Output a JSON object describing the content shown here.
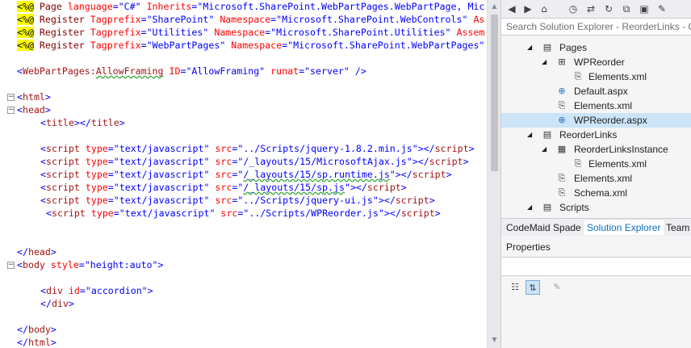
{
  "editor": {
    "lines": {
      "l1": {
        "a": "<%@",
        "b": " Page ",
        "c": "language",
        "d": "=",
        "e": "\"C#\"",
        "f": " Inherits",
        "g": "=",
        "h": "\"Microsoft.SharePoint.WebPartPages.WebPartPage, Mic"
      },
      "l2": {
        "a": "<%@",
        "b": " Register ",
        "c": "Tagprefix",
        "d": "=",
        "e": "\"SharePoint\"",
        "f": " Namespace",
        "g": "=",
        "h": "\"Microsoft.SharePoint.WebControls\"",
        "i": " As"
      },
      "l3": {
        "a": "<%@",
        "b": " Register ",
        "c": "Tagprefix",
        "d": "=",
        "e": "\"Utilities\"",
        "f": " Namespace",
        "g": "=",
        "h": "\"Microsoft.SharePoint.Utilities\"",
        "i": " Assem"
      },
      "l4": {
        "a": "<%@",
        "b": " Register ",
        "c": "Tagprefix",
        "d": "=",
        "e": "\"WebPartPages\"",
        "f": " Namespace",
        "g": "=",
        "h": "\"Microsoft.SharePoint.WebPartPages\""
      },
      "l5": {
        "a": "<",
        "b": "WebPartPages:",
        "c": "AllowFraming",
        "d": " ID",
        "e": "=",
        "f": "\"AllowFraming\"",
        "g": " runat",
        "h": "=",
        "i": "\"server\"",
        "j": " />"
      },
      "l6": {
        "a": "<",
        "b": "html",
        "c": ">"
      },
      "l7": {
        "a": "<",
        "b": "head",
        "c": ">"
      },
      "l8": {
        "a": "<",
        "b": "title",
        "c": "></",
        "d": "title",
        "e": ">"
      },
      "s1": {
        "a": "<",
        "b": "script",
        "c": " type",
        "d": "=",
        "e": "\"text/javascript\"",
        "f": " src",
        "g": "=",
        "h": "\"../Scripts/jquery-1.8.2.min.js\"",
        "i": "></",
        "j": "script",
        "k": ">"
      },
      "s2": {
        "a": "<",
        "b": "script",
        "c": " type",
        "d": "=",
        "e": "\"text/javascript\"",
        "f": " src",
        "g": "=",
        "h": "\"/_layouts/15/MicrosoftAjax.js\"",
        "i": "></",
        "j": "script",
        "k": ">"
      },
      "s3": {
        "a": "<",
        "b": "script",
        "c": " type",
        "d": "=",
        "e": "\"text/javascript\"",
        "f": " src",
        "g": "=",
        "h1": "\"",
        "h2": "/_layouts/15/sp.runtime.js",
        "h3": "\"",
        "i": "></",
        "j": "script",
        "k": ">"
      },
      "s4": {
        "a": "<",
        "b": "script",
        "c": " type",
        "d": "=",
        "e": "\"text/javascript\"",
        "f": " src",
        "g": "=",
        "h1": "\"",
        "h2": "/_layouts/15/sp.js",
        "h3": "\"",
        "i": "></",
        "j": "script",
        "k": ">"
      },
      "s5": {
        "a": "<",
        "b": "script",
        "c": " type",
        "d": "=",
        "e": "\"text/javascript\"",
        "f": " src",
        "g": "=",
        "h": "\"../Scripts/jquery-ui.js\"",
        "i": "></",
        "j": "script",
        "k": ">"
      },
      "s6": {
        "a": "<",
        "b": "script",
        "c": " type",
        "d": "=",
        "e": "\"text/javascript\"",
        "f": " src",
        "g": "=",
        "h": "\"../Scripts/WPReorder.js\"",
        "i": "></",
        "j": "script",
        "k": ">"
      },
      "l9": {
        "a": "</",
        "b": "head",
        "c": ">"
      },
      "l10": {
        "a": "<",
        "b": "body",
        "c": " style",
        "d": "=",
        "e": "\"height:auto\"",
        "f": ">"
      },
      "l11": {
        "a": "<",
        "b": "div",
        "c": " id",
        "d": "=",
        "e": "\"accordion\"",
        "f": ">"
      },
      "l12": {
        "a": "</",
        "b": "div",
        "c": ">"
      },
      "l13": {
        "a": "</",
        "b": "body",
        "c": ">"
      },
      "l14": {
        "a": "</",
        "b": "html",
        "c": ">"
      }
    },
    "fold_minus": "−"
  },
  "explorer": {
    "search_placeholder": "Search Solution Explorer - ReorderLinks - Ctrl+;",
    "toolbar_icons": [
      "back-icon",
      "forward-icon",
      "home-icon",
      "history-icon",
      "sync-icon",
      "refresh-icon",
      "collapse-icon",
      "properties-icon"
    ],
    "tree": {
      "pages": "Pages",
      "wpreorder": "WPReorder",
      "elements1": "Elements.xml",
      "default": "Default.aspx",
      "elements2": "Elements.xml",
      "wpreorder_aspx": "WPReorder.aspx",
      "reorderlinks": "ReorderLinks",
      "instance": "ReorderLinksInstance",
      "elements3": "Elements.xml",
      "elements4": "Elements.xml",
      "schema": "Schema.xml",
      "scripts": "Scripts"
    },
    "tabs": {
      "codemaid": "CodeMaid Spade",
      "solution": "Solution Explorer",
      "team": "Team"
    }
  },
  "properties": {
    "title": "Properties"
  },
  "colors": {
    "selection": "#cce4f7",
    "active_tab": "#0e70c0",
    "directive_highlight": "#ffff00"
  }
}
